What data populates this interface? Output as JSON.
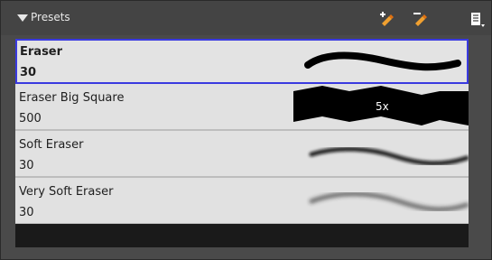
{
  "panel": {
    "title": "Presets",
    "icons": [
      "collapse-triangle-icon",
      "new-preset-icon",
      "rename-preset-icon",
      "panel-menu-icon"
    ]
  },
  "presets": [
    {
      "name": "Eraser",
      "size": "30",
      "selected": true
    },
    {
      "name": "Eraser Big Square",
      "size": "500",
      "selected": false,
      "preview_label": "5x"
    },
    {
      "name": "Soft Eraser",
      "size": "30",
      "selected": false
    },
    {
      "name": "Very Soft Eraser",
      "size": "30",
      "selected": false
    }
  ],
  "colors": {
    "selection_border": "#3a3ae0",
    "list_background": "#e1e1e1",
    "panel_background": "#4a4a4a",
    "icon_accent": "#f0a030"
  }
}
